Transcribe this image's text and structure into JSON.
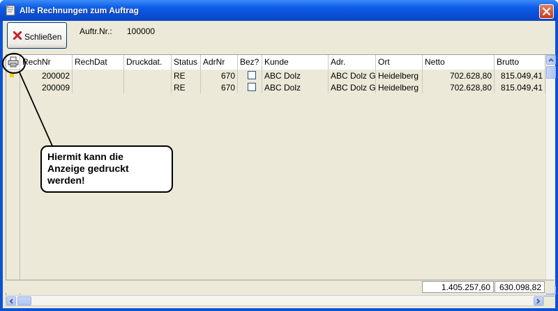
{
  "window": {
    "title": "Alle Rechnungen zum Auftrag",
    "title_icon": "invoice-icon",
    "close_icon": "close-icon"
  },
  "toolbar": {
    "close_label": "Schließen",
    "auftr_label": "Auftr.Nr.:",
    "auftr_value": "100000"
  },
  "grid": {
    "columns": [
      "RechNr",
      "RechDat",
      "Druckdat.",
      "Status",
      "AdrNr",
      "Bez?",
      "Kunde",
      "Adr.",
      "Ort",
      "Netto",
      "Brutto"
    ],
    "rows": [
      {
        "rechnr": "200002",
        "rechdat": "",
        "druckdat": "",
        "status": "RE",
        "adrnr": "670",
        "bez": false,
        "kunde": "ABC Dolz",
        "adr": "ABC Dolz G",
        "ort": "Heidelberg",
        "netto": "702.628,80",
        "brutto": "815.049,41"
      },
      {
        "rechnr": "200009",
        "rechdat": "",
        "druckdat": "",
        "status": "RE",
        "adrnr": "670",
        "bez": false,
        "kunde": "ABC Dolz",
        "adr": "ABC Dolz G",
        "ort": "Heidelberg",
        "netto": "702.628,80",
        "brutto": "815.049,41"
      }
    ],
    "sum_netto": "1.405.257,60",
    "sum_brutto": "630.098,82"
  },
  "callout": {
    "text_line1": "Hiermit kann die",
    "text_line2": "Anzeige gedruckt",
    "text_line3": "werden!"
  },
  "colors": {
    "titlebar": "#0a52d6",
    "client_bg": "#ece9d8",
    "close_button": "#c4391a"
  }
}
